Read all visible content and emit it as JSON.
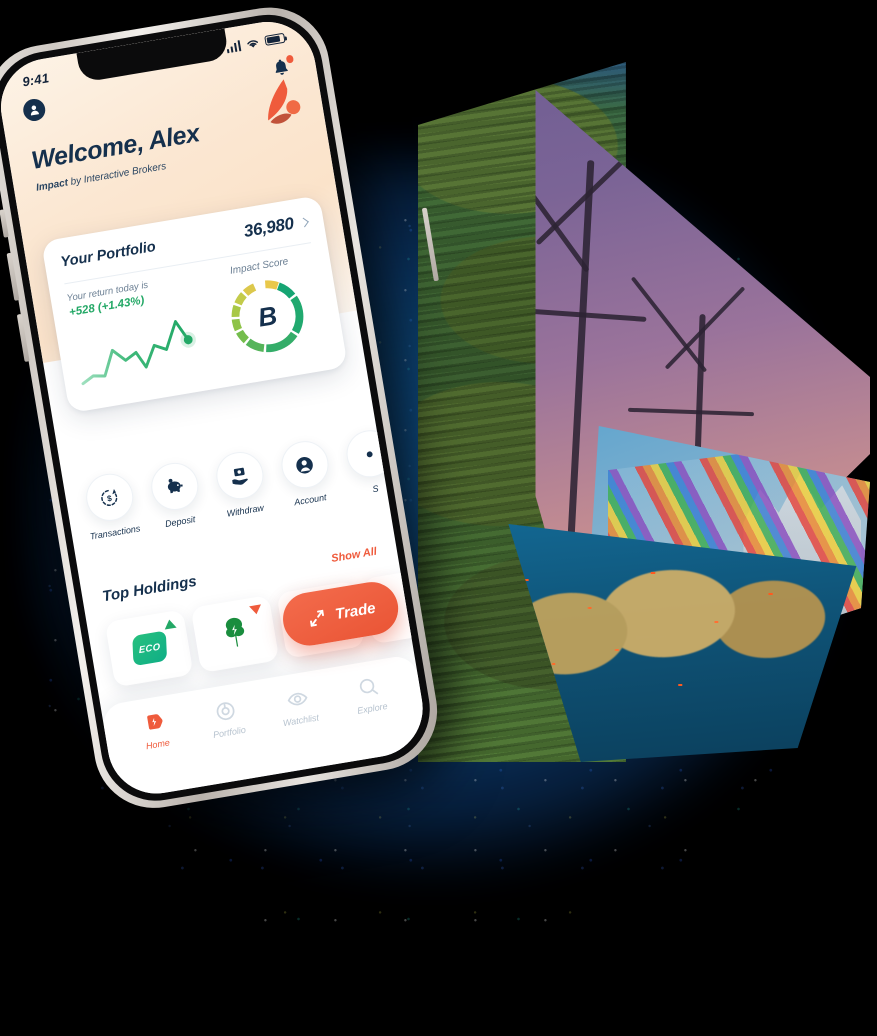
{
  "app": {
    "brand_name": "Impact",
    "brand_tagline": "by Interactive Brokers",
    "accent_orange": "#ef5b3c",
    "accent_navy": "#15304d",
    "accent_green": "#23a866"
  },
  "status_bar": {
    "time": "9:41",
    "signal_icon": "signal-bars-icon",
    "wifi_icon": "wifi-icon",
    "battery_icon": "battery-icon"
  },
  "header": {
    "avatar_icon": "user-avatar-icon",
    "notification_icon": "bell-icon",
    "has_notification_dot": true,
    "greeting": "Welcome, Alex",
    "logo_icon": "impact-leaf-logo"
  },
  "portfolio_card": {
    "title": "Your Portfolio",
    "value": "36,980",
    "chevron_icon": "chevron-right-icon",
    "return_label": "Your return today is",
    "return_value": "+528 (+1.43%)",
    "impact_label": "Impact Score",
    "impact_grade": "B"
  },
  "quick_actions": [
    {
      "label": "Transactions",
      "icon": "transactions-icon"
    },
    {
      "label": "Deposit",
      "icon": "piggy-bank-icon"
    },
    {
      "label": "Withdraw",
      "icon": "withdraw-cash-icon"
    },
    {
      "label": "Account",
      "icon": "account-person-icon"
    },
    {
      "label": "S",
      "icon": "settings-icon"
    }
  ],
  "holdings": {
    "title": "Top Holdings",
    "show_all_label": "Show All",
    "items": [
      {
        "symbol": "ECO",
        "icon": "eco-tile-icon",
        "trend": "up"
      },
      {
        "symbol": "",
        "icon": "tree-leaf-icon",
        "trend": "down"
      },
      {
        "symbol": "",
        "icon": "holding-icon",
        "trend": "up"
      }
    ]
  },
  "trade_button": {
    "label": "Trade",
    "icon": "trade-arrows-icon"
  },
  "bottom_nav": [
    {
      "label": "Home",
      "icon": "home-tag-icon",
      "active": true
    },
    {
      "label": "Portfolio",
      "icon": "portfolio-coin-icon",
      "active": false
    },
    {
      "label": "Watchlist",
      "icon": "eye-icon",
      "active": false
    },
    {
      "label": "Explore",
      "icon": "search-icon",
      "active": false
    }
  ],
  "collage": {
    "wedges": [
      {
        "name": "forest",
        "description": "evergreen conifer forest"
      },
      {
        "name": "wind",
        "description": "wind turbines at sunset"
      },
      {
        "name": "pride",
        "description": "rainbow pride flags"
      },
      {
        "name": "reef",
        "description": "coral reef with fish"
      }
    ]
  }
}
